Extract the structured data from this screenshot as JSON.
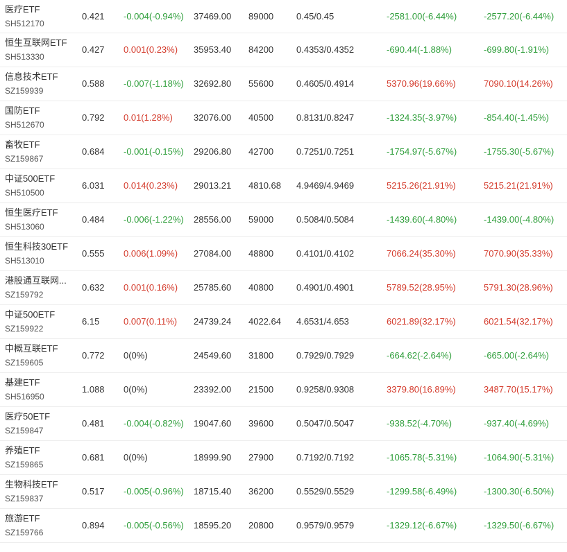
{
  "colors": {
    "up": "#d43a2b",
    "down": "#2e9e3a",
    "flat": "#333333",
    "divider": "#ececec"
  },
  "rows": [
    {
      "name": "医疗ETF",
      "code": "SH512170",
      "price": "0.421",
      "change": "-0.004(-0.94%)",
      "change_dir": "down",
      "amount": "37469.00",
      "volume": "89000",
      "bid_ask": "0.45/0.45",
      "flow1": "-2581.00(-6.44%)",
      "flow1_dir": "down",
      "flow2": "-2577.20(-6.44%)",
      "flow2_dir": "down"
    },
    {
      "name": "恒生互联网ETF",
      "code": "SH513330",
      "price": "0.427",
      "change": "0.001(0.23%)",
      "change_dir": "up",
      "amount": "35953.40",
      "volume": "84200",
      "bid_ask": "0.4353/0.4352",
      "flow1": "-690.44(-1.88%)",
      "flow1_dir": "down",
      "flow2": "-699.80(-1.91%)",
      "flow2_dir": "down"
    },
    {
      "name": "信息技术ETF",
      "code": "SZ159939",
      "price": "0.588",
      "change": "-0.007(-1.18%)",
      "change_dir": "down",
      "amount": "32692.80",
      "volume": "55600",
      "bid_ask": "0.4605/0.4914",
      "flow1": "5370.96(19.66%)",
      "flow1_dir": "up",
      "flow2": "7090.10(14.26%)",
      "flow2_dir": "up"
    },
    {
      "name": "国防ETF",
      "code": "SH512670",
      "price": "0.792",
      "change": "0.01(1.28%)",
      "change_dir": "up",
      "amount": "32076.00",
      "volume": "40500",
      "bid_ask": "0.8131/0.8247",
      "flow1": "-1324.35(-3.97%)",
      "flow1_dir": "down",
      "flow2": "-854.40(-1.45%)",
      "flow2_dir": "down"
    },
    {
      "name": "畜牧ETF",
      "code": "SZ159867",
      "price": "0.684",
      "change": "-0.001(-0.15%)",
      "change_dir": "down",
      "amount": "29206.80",
      "volume": "42700",
      "bid_ask": "0.7251/0.7251",
      "flow1": "-1754.97(-5.67%)",
      "flow1_dir": "down",
      "flow2": "-1755.30(-5.67%)",
      "flow2_dir": "down"
    },
    {
      "name": "中证500ETF",
      "code": "SH510500",
      "price": "6.031",
      "change": "0.014(0.23%)",
      "change_dir": "up",
      "amount": "29013.21",
      "volume": "4810.68",
      "bid_ask": "4.9469/4.9469",
      "flow1": "5215.26(21.91%)",
      "flow1_dir": "up",
      "flow2": "5215.21(21.91%)",
      "flow2_dir": "up"
    },
    {
      "name": "恒生医疗ETF",
      "code": "SH513060",
      "price": "0.484",
      "change": "-0.006(-1.22%)",
      "change_dir": "down",
      "amount": "28556.00",
      "volume": "59000",
      "bid_ask": "0.5084/0.5084",
      "flow1": "-1439.60(-4.80%)",
      "flow1_dir": "down",
      "flow2": "-1439.00(-4.80%)",
      "flow2_dir": "down"
    },
    {
      "name": "恒生科技30ETF",
      "code": "SH513010",
      "price": "0.555",
      "change": "0.006(1.09%)",
      "change_dir": "up",
      "amount": "27084.00",
      "volume": "48800",
      "bid_ask": "0.4101/0.4102",
      "flow1": "7066.24(35.30%)",
      "flow1_dir": "up",
      "flow2": "7070.90(35.33%)",
      "flow2_dir": "up"
    },
    {
      "name": "港股通互联网...",
      "code": "SZ159792",
      "price": "0.632",
      "change": "0.001(0.16%)",
      "change_dir": "up",
      "amount": "25785.60",
      "volume": "40800",
      "bid_ask": "0.4901/0.4901",
      "flow1": "5789.52(28.95%)",
      "flow1_dir": "up",
      "flow2": "5791.30(28.96%)",
      "flow2_dir": "up"
    },
    {
      "name": "中证500ETF",
      "code": "SZ159922",
      "price": "6.15",
      "change": "0.007(0.11%)",
      "change_dir": "up",
      "amount": "24739.24",
      "volume": "4022.64",
      "bid_ask": "4.6531/4.653",
      "flow1": "6021.89(32.17%)",
      "flow1_dir": "up",
      "flow2": "6021.54(32.17%)",
      "flow2_dir": "up"
    },
    {
      "name": "中概互联ETF",
      "code": "SZ159605",
      "price": "0.772",
      "change": "0(0%)",
      "change_dir": "flat",
      "amount": "24549.60",
      "volume": "31800",
      "bid_ask": "0.7929/0.7929",
      "flow1": "-664.62(-2.64%)",
      "flow1_dir": "down",
      "flow2": "-665.00(-2.64%)",
      "flow2_dir": "down"
    },
    {
      "name": "基建ETF",
      "code": "SH516950",
      "price": "1.088",
      "change": "0(0%)",
      "change_dir": "flat",
      "amount": "23392.00",
      "volume": "21500",
      "bid_ask": "0.9258/0.9308",
      "flow1": "3379.80(16.89%)",
      "flow1_dir": "up",
      "flow2": "3487.70(15.17%)",
      "flow2_dir": "up"
    },
    {
      "name": "医疗50ETF",
      "code": "SZ159847",
      "price": "0.481",
      "change": "-0.004(-0.82%)",
      "change_dir": "down",
      "amount": "19047.60",
      "volume": "39600",
      "bid_ask": "0.5047/0.5047",
      "flow1": "-938.52(-4.70%)",
      "flow1_dir": "down",
      "flow2": "-937.40(-4.69%)",
      "flow2_dir": "down"
    },
    {
      "name": "养殖ETF",
      "code": "SZ159865",
      "price": "0.681",
      "change": "0(0%)",
      "change_dir": "flat",
      "amount": "18999.90",
      "volume": "27900",
      "bid_ask": "0.7192/0.7192",
      "flow1": "-1065.78(-5.31%)",
      "flow1_dir": "down",
      "flow2": "-1064.90(-5.31%)",
      "flow2_dir": "down"
    },
    {
      "name": "生物科技ETF",
      "code": "SZ159837",
      "price": "0.517",
      "change": "-0.005(-0.96%)",
      "change_dir": "down",
      "amount": "18715.40",
      "volume": "36200",
      "bid_ask": "0.5529/0.5529",
      "flow1": "-1299.58(-6.49%)",
      "flow1_dir": "down",
      "flow2": "-1300.30(-6.50%)",
      "flow2_dir": "down"
    },
    {
      "name": "旅游ETF",
      "code": "SZ159766",
      "price": "0.894",
      "change": "-0.005(-0.56%)",
      "change_dir": "down",
      "amount": "18595.20",
      "volume": "20800",
      "bid_ask": "0.9579/0.9579",
      "flow1": "-1329.12(-6.67%)",
      "flow1_dir": "down",
      "flow2": "-1329.50(-6.67%)",
      "flow2_dir": "down"
    }
  ]
}
